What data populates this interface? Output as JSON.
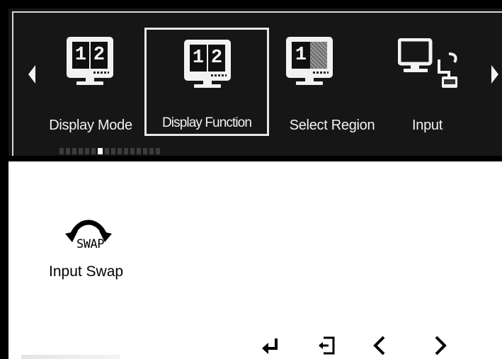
{
  "menu": {
    "items": [
      {
        "label": "Display Mode",
        "icon": "dual-monitor-icon",
        "panels": [
          "1",
          "2"
        ],
        "selected": false
      },
      {
        "label": "Display Function",
        "icon": "dual-monitor-icon",
        "panels": [
          "1",
          "2"
        ],
        "selected": true
      },
      {
        "label": "Select Region",
        "icon": "region-monitor-icon",
        "panels": [
          "1"
        ],
        "selected": false
      },
      {
        "label": "Input",
        "icon": "computer-input-icon",
        "panels": [],
        "selected": false
      }
    ],
    "page_indicator": {
      "total": 16,
      "active": 6
    }
  },
  "function": {
    "icon_text": "SWAP",
    "label": "Input Swap"
  },
  "nav_buttons": [
    {
      "name": "enter-icon"
    },
    {
      "name": "exit-icon"
    },
    {
      "name": "left-arrow-icon"
    },
    {
      "name": "right-arrow-icon"
    }
  ],
  "colors": {
    "menu_bg": "#161616",
    "menu_text": "#f2f2f2",
    "content_bg": "#ffffff"
  }
}
